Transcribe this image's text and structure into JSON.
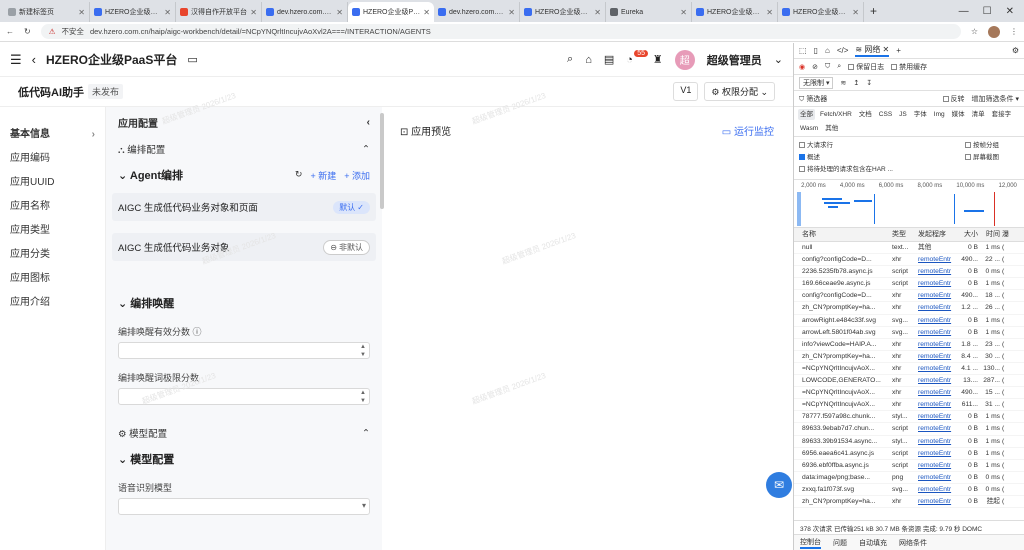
{
  "tabs": [
    {
      "label": "新建标签页",
      "color": "#9aa0a6",
      "active": false
    },
    {
      "label": "HZERO企业级PaaS平",
      "color": "#3a6df0",
      "active": false
    },
    {
      "label": "汉得自作开放平台",
      "color": "#e8452c",
      "active": false
    },
    {
      "label": "dev.hzero.com.cn/p",
      "color": "#3a6df0",
      "active": false
    },
    {
      "label": "HZERO企业级PaaS平",
      "color": "#3a6df0",
      "active": true
    },
    {
      "label": "dev.hzero.com.cn/v",
      "color": "#3a6df0",
      "active": false
    },
    {
      "label": "HZERO企业级PaaS平",
      "color": "#3a6df0",
      "active": false
    },
    {
      "label": "Eureka",
      "color": "#5f6368",
      "active": false
    },
    {
      "label": "HZERO企业级PaaS平",
      "color": "#3a6df0",
      "active": false
    },
    {
      "label": "HZERO企业级PaaS平",
      "color": "#3a6df0",
      "active": false
    }
  ],
  "address": {
    "security": "不安全",
    "url": "dev.hzero.com.cn/haip/aigc-workbench/detail/=NCpYNQrltIncujvAoXvl2A===/INTERACTION/AGENTS"
  },
  "header": {
    "brand": "HZERO企业级PaaS平台",
    "notify_count": "55",
    "avatar_char": "超",
    "user": "超级管理员"
  },
  "subheader": {
    "title": "低代码AI助手",
    "status": "未发布",
    "version": "V1",
    "perm": "权限分配"
  },
  "nav": [
    "基本信息",
    "应用编码",
    "应用UUID",
    "应用名称",
    "应用类型",
    "应用分类",
    "应用图标",
    "应用介绍"
  ],
  "config": {
    "title": "应用配置",
    "section1": "编排配置",
    "agent_head": "Agent编排",
    "new": "新建",
    "add": "添加",
    "agent1": "AIGC 生成低代码业务对象和页面",
    "agent1_chip": "默认",
    "agent2": "AIGC 生成低代码业务对象",
    "agent2_chip": "非默认",
    "wake_head": "编排唤醒",
    "wake_score": "编排唤醒有效分数",
    "wake_limit": "编排唤醒词极限分数",
    "section2": "模型配置",
    "model_head": "模型配置",
    "asr": "语音识别模型"
  },
  "preview": {
    "title": "应用预览",
    "monitor": "运行监控"
  },
  "watermark": "超级管理员 2026/1/23",
  "devtools": {
    "tabs": [
      "网络"
    ],
    "preserve_log": "保留日志",
    "disable_cache": "禁用缓存",
    "throttle": "无限制",
    "filter": "筛选器",
    "invert": "反转",
    "more_filters": "增加筛选条件",
    "types": [
      "全部",
      "Fetch/XHR",
      "文档",
      "CSS",
      "JS",
      "字体",
      "Img",
      "媒体",
      "清单",
      "套接字",
      "Wasm",
      "其他"
    ],
    "opt_big": "大请求行",
    "opt_group": "按帧分组",
    "opt_overview": "概述",
    "opt_screen": "屏幕截图",
    "opt_har": "将待处理的请求包含在HAR ...",
    "scale": [
      "2,000 ms",
      "4,000 ms",
      "6,000 ms",
      "8,000 ms",
      "10,000 ms",
      "12,000"
    ],
    "cols": [
      "名称",
      "类型",
      "发起程序",
      "大小",
      "时间",
      "瀑"
    ],
    "rows": [
      [
        "null",
        "text...",
        "其他",
        "0 B",
        "1 ms"
      ],
      [
        "config?configCode=D...",
        "xhr",
        "remoteEntr",
        "490...",
        "22 ..."
      ],
      [
        "2236.5235fb78.async.js",
        "script",
        "remoteEntr",
        "0 B",
        "0 ms"
      ],
      [
        "169.66ceae9e.async.js",
        "script",
        "remoteEntr",
        "0 B",
        "1 ms"
      ],
      [
        "config?configCode=D...",
        "xhr",
        "remoteEntr",
        "490...",
        "18 ..."
      ],
      [
        "zh_CN?promptKey=ha...",
        "xhr",
        "remoteEntr",
        "1.2 ...",
        "26 ..."
      ],
      [
        "arrowRight.e484c33f.svg",
        "svg...",
        "remoteEntr",
        "0 B",
        "1 ms"
      ],
      [
        "arrowLeft.5801f04ab.svg",
        "svg...",
        "remoteEntr",
        "0 B",
        "1 ms"
      ],
      [
        "info?viewCode=HAIP.A...",
        "xhr",
        "remoteEntr",
        "1.8 ...",
        "23 ..."
      ],
      [
        "zh_CN?promptKey=ha...",
        "xhr",
        "remoteEntr",
        "8.4 ...",
        "30 ..."
      ],
      [
        "=NCpYNQrltIncujvAoX...",
        "xhr",
        "remoteEntr",
        "4.1 ...",
        "130..."
      ],
      [
        "LOWCODE,GENERATO...",
        "xhr",
        "remoteEntr",
        "13....",
        "287..."
      ],
      [
        "=NCpYNQrltIncujvAoX...",
        "xhr",
        "remoteEntr",
        "490...",
        "15 ..."
      ],
      [
        "=NCpYNQrltIncujvAoX...",
        "xhr",
        "remoteEntr",
        "611...",
        "31 ..."
      ],
      [
        "78777.f597a98c.chunk...",
        "styl...",
        "remoteEntr",
        "0 B",
        "1 ms"
      ],
      [
        "89633.9ebab7d7.chun...",
        "script",
        "remoteEntr",
        "0 B",
        "1 ms"
      ],
      [
        "89633.39b91534.async...",
        "styl...",
        "remoteEntr",
        "0 B",
        "1 ms"
      ],
      [
        "6956.eaea6c41.async.js",
        "script",
        "remoteEntr",
        "0 B",
        "1 ms"
      ],
      [
        "6936.ebf0ffba.async.js",
        "script",
        "remoteEntr",
        "0 B",
        "1 ms"
      ],
      [
        "data:image/png;base...",
        "png",
        "remoteEntr",
        "0 B",
        "0 ms"
      ],
      [
        "zxxq.fa1f073f.svg",
        "svg...",
        "remoteEntr",
        "0 B",
        "0 ms"
      ],
      [
        "zh_CN?promptKey=ha...",
        "xhr",
        "remoteEntr",
        "0 B",
        "挂起"
      ]
    ],
    "status": "378 次请求  已传输251 kB  30.7 MB 条资源  完成: 9.79 秒  DOMC",
    "drawer": [
      "控制台",
      "问题",
      "自动填充",
      "网络条件"
    ]
  }
}
